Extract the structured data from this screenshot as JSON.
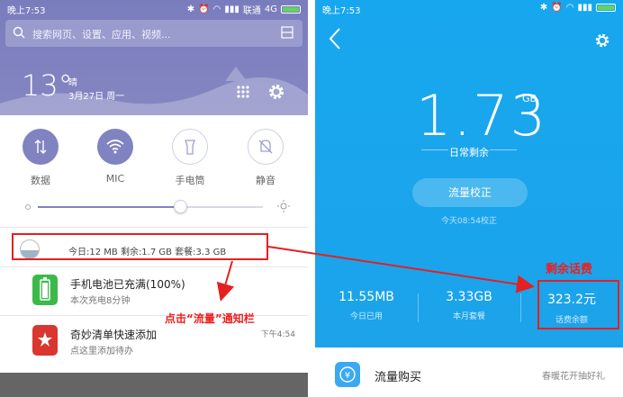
{
  "left": {
    "status": {
      "time": "晚上7:53",
      "carrier": "联通",
      "network": "4G"
    },
    "search": {
      "placeholder": "搜索网页、设置、应用、视频..."
    },
    "weather": {
      "temp": "13°",
      "condition": "晴",
      "date": "3月27日 周一"
    },
    "quick_settings": [
      {
        "label": "数据",
        "active": true
      },
      {
        "label": "MIC",
        "active": true
      },
      {
        "label": "手电筒",
        "active": false
      },
      {
        "label": "静音",
        "active": false
      }
    ],
    "brightness": 0.63,
    "traffic": {
      "text": "今日:12 MB  剩余:1.7 GB  套餐:3.3 GB"
    },
    "notifications": [
      {
        "title": "手机电池已充满(100%)",
        "subtitle": "本次充电8分钟",
        "time": ""
      },
      {
        "title": "奇妙清单快速添加",
        "subtitle": "点这里添加待办",
        "time": "下午4:54"
      }
    ],
    "annotation": "点击“流量”通知栏"
  },
  "right": {
    "status": {
      "time": "晚上7:53"
    },
    "remaining": {
      "value": "1.73",
      "unit": "GB",
      "label": "日常剩余"
    },
    "calibrate": {
      "label": "流量校正",
      "time": "今天08:54校正"
    },
    "stats": [
      {
        "value": "11.55MB",
        "label": "今日已用"
      },
      {
        "value": "3.33GB",
        "label": "本月套餐"
      },
      {
        "value": "323.2元",
        "label": "话费余额"
      }
    ],
    "buy": {
      "label": "流量购买",
      "promo": "春暖花开抽好礼"
    },
    "annotation": "剩余话费"
  },
  "colors": {
    "accent_left": "#7f82be",
    "accent_right": "#18a6ee",
    "annotation": "#e42020"
  }
}
